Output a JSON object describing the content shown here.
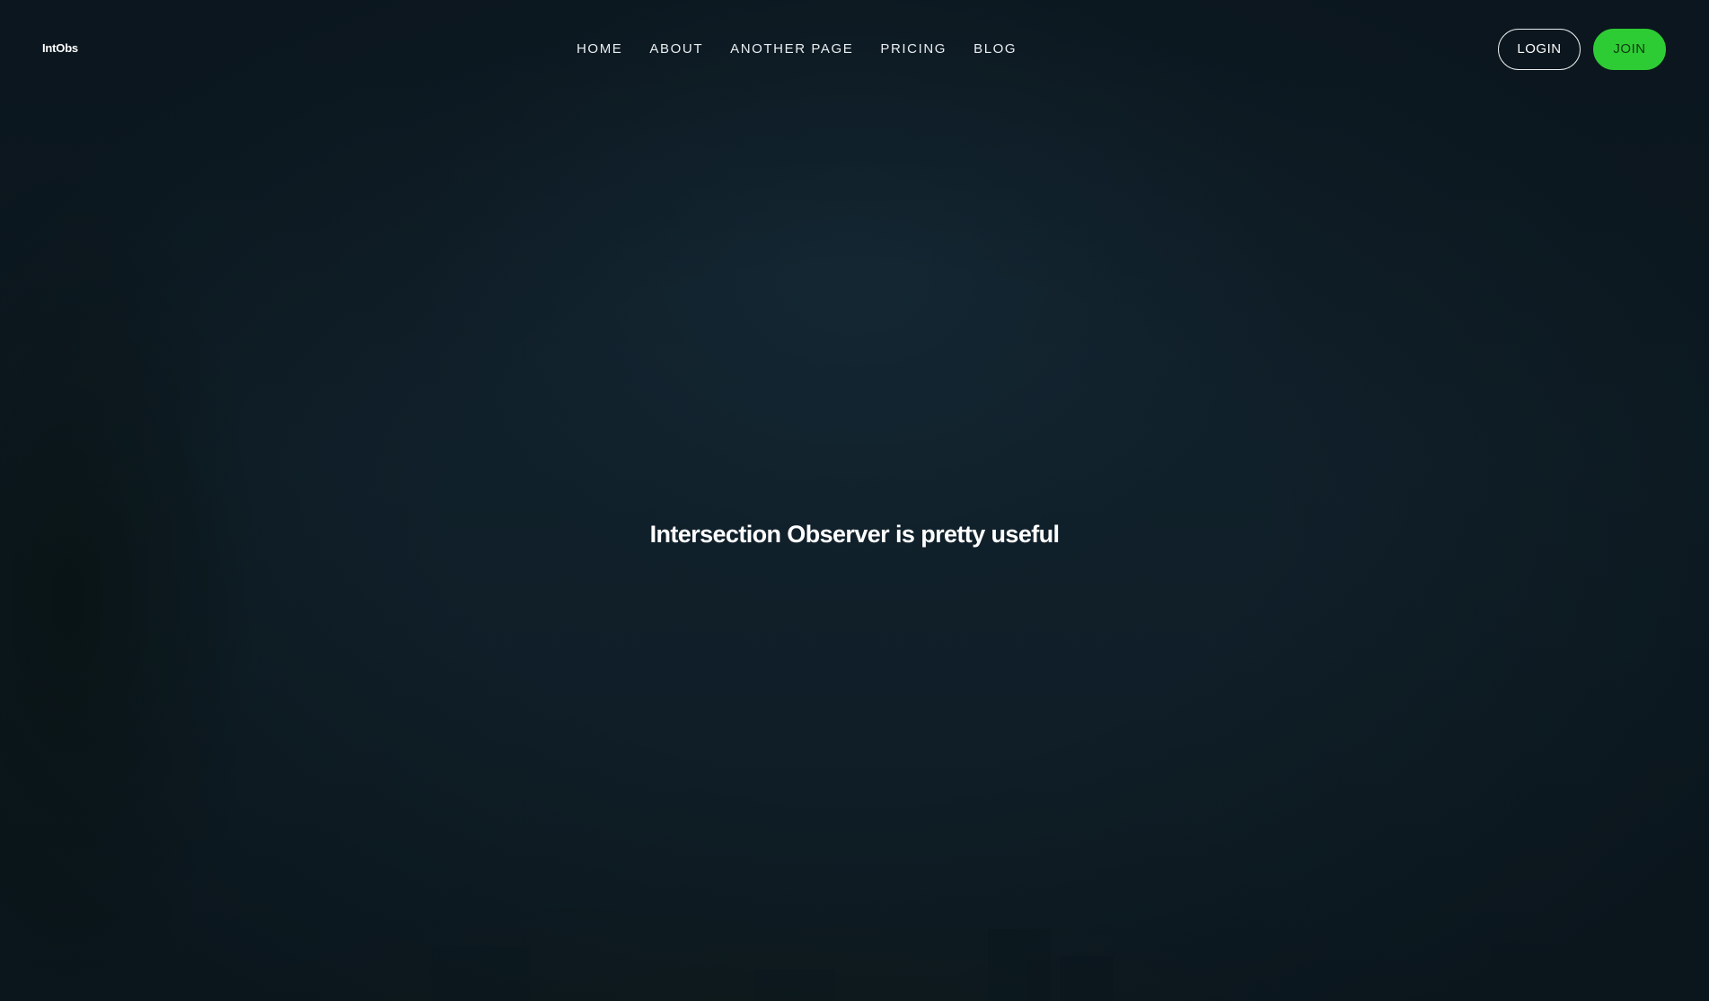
{
  "brand": {
    "logo_text": "IntObs"
  },
  "nav": {
    "items": [
      {
        "label": "HOME"
      },
      {
        "label": "ABOUT"
      },
      {
        "label": "ANOTHER PAGE"
      },
      {
        "label": "PRICING"
      },
      {
        "label": "BLOG"
      }
    ]
  },
  "auth": {
    "login_label": "LOGIN",
    "join_label": "JOIN"
  },
  "hero": {
    "headline": "Intersection Observer is pretty useful"
  },
  "colors": {
    "background": "#0f1c26",
    "accent": "#2ecc34",
    "text": "#ffffff"
  }
}
